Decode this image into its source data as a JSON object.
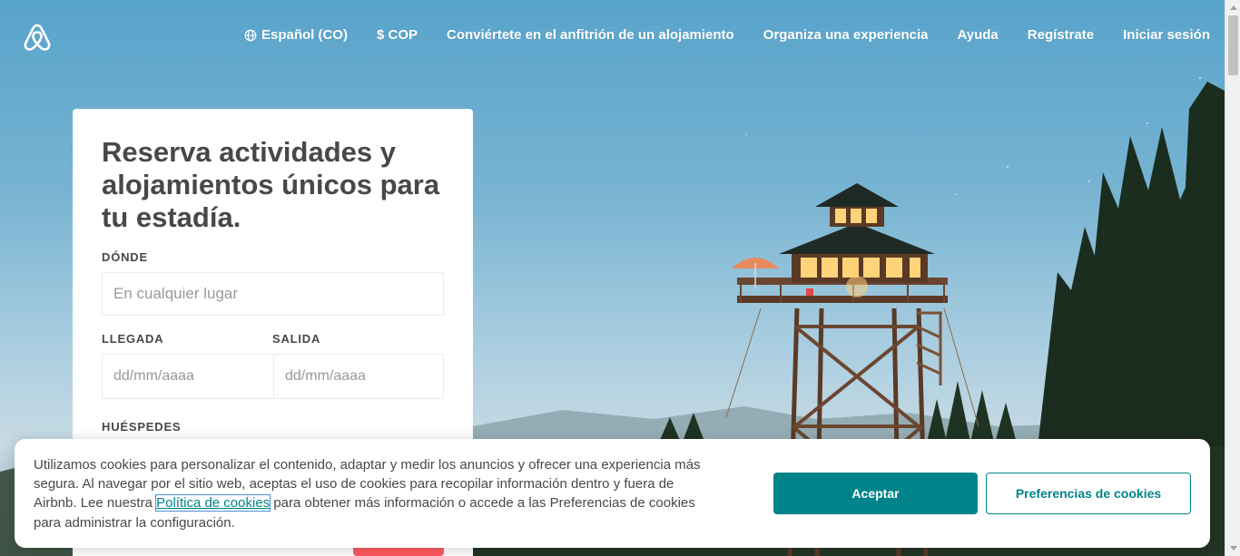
{
  "header": {
    "nav": {
      "language": "Español (CO)",
      "currency": "$ COP",
      "host_home": "Conviértete en el anfitrión de un alojamiento",
      "host_experience": "Organiza una experiencia",
      "help": "Ayuda",
      "signup": "Regístrate",
      "login": "Iniciar sesión"
    }
  },
  "search": {
    "title": "Reserva actividades y alojamientos únicos para tu estadía.",
    "where_label": "DÓNDE",
    "where_placeholder": "En cualquier lugar",
    "checkin_label": "LLEGADA",
    "checkin_placeholder": "dd/mm/aaaa",
    "checkout_label": "SALIDA",
    "checkout_placeholder": "dd/mm/aaaa",
    "guests_label": "HUÉSPEDES"
  },
  "cookie_banner": {
    "text_before": "Utilizamos cookies para personalizar el contenido, adaptar y medir los anuncios y ofrecer una experiencia más segura. Al navegar por el sitio web, aceptas el uso de cookies para recopilar información dentro y fuera de Airbnb. Lee nuestra ",
    "link": "Política de cookies",
    "text_after": " para obtener más información o accede a las Preferencias de cookies para administrar la configuración.",
    "accept": "Aceptar",
    "preferences": "Preferencias de cookies"
  },
  "colors": {
    "accent": "#008489",
    "brand": "#ff5a5f",
    "text": "#484848"
  },
  "icons": {
    "logo": "airbnb-logo-icon",
    "language": "globe-icon"
  }
}
